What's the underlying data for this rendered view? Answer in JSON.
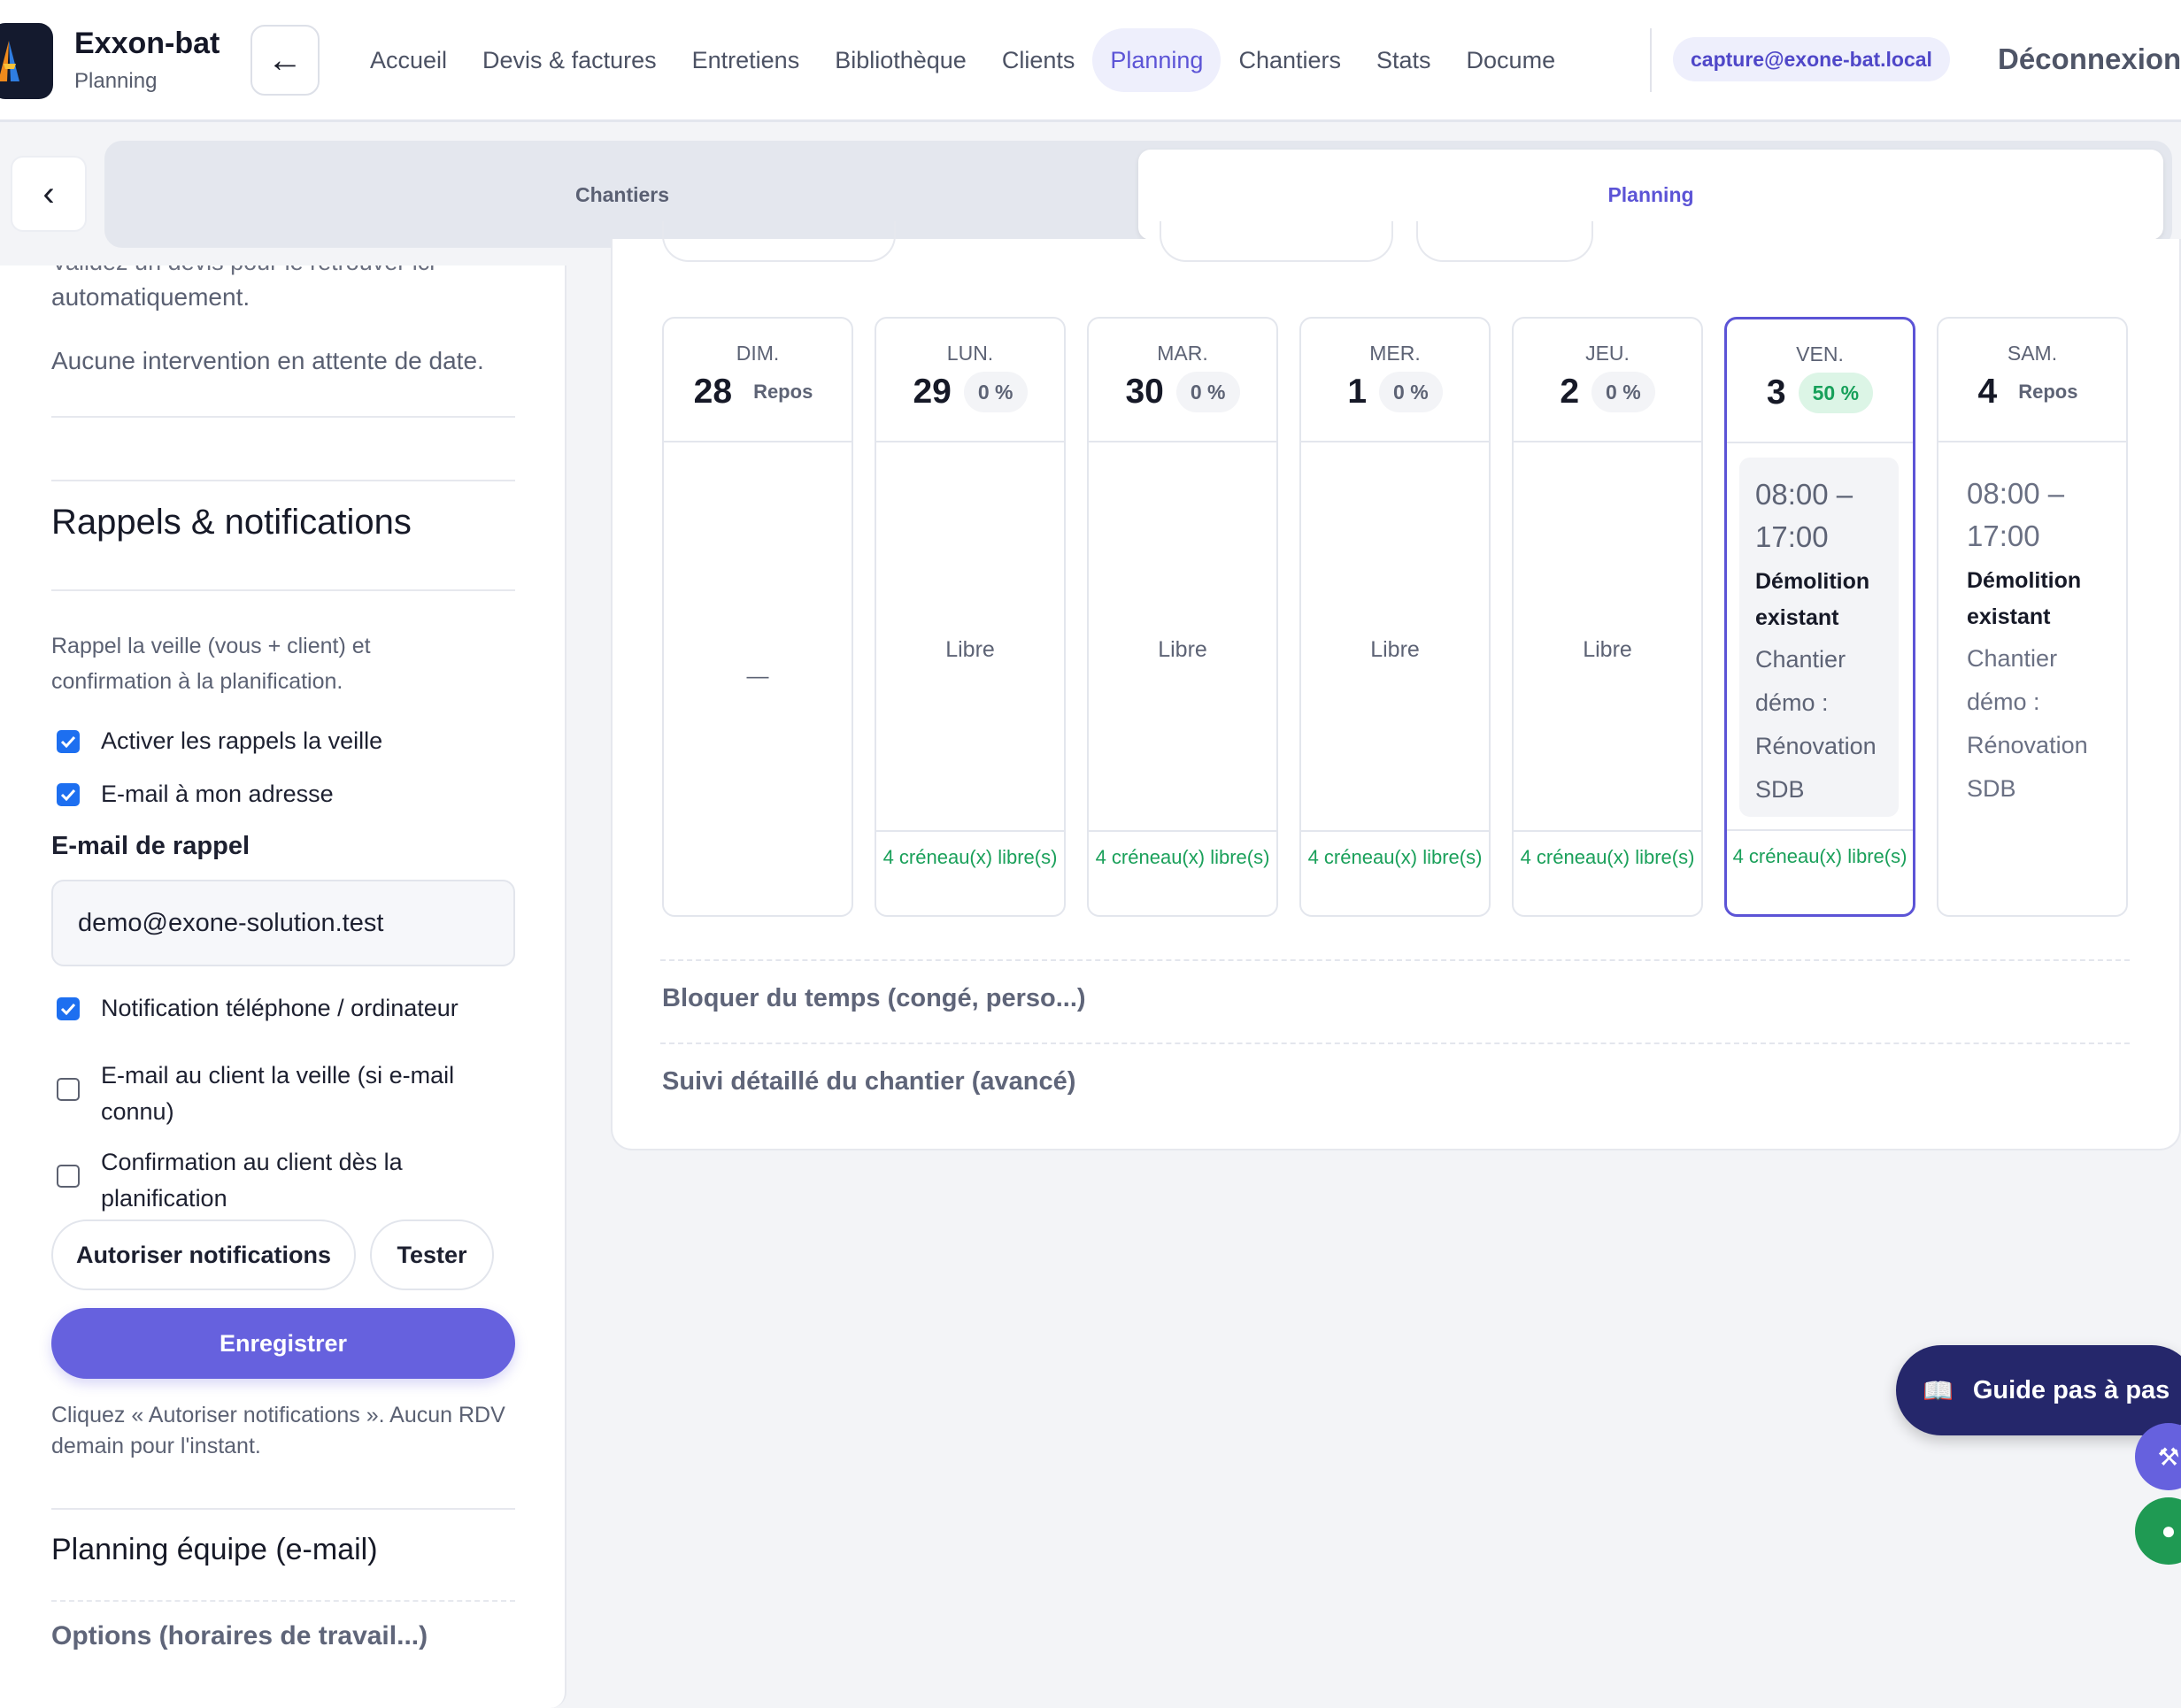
{
  "header": {
    "app_name": "Exxon-bat",
    "app_subtitle": "Planning",
    "back_icon": "arrow-left-icon",
    "nav": [
      {
        "label": "Accueil",
        "active": false
      },
      {
        "label": "Devis & factures",
        "active": false
      },
      {
        "label": "Entretiens",
        "active": false
      },
      {
        "label": "Bibliothèque",
        "active": false
      },
      {
        "label": "Clients",
        "active": false
      },
      {
        "label": "Planning",
        "active": true
      },
      {
        "label": "Chantiers",
        "active": false
      },
      {
        "label": "Stats",
        "active": false
      },
      {
        "label": "Docume",
        "active": false
      }
    ],
    "user_email": "capture@exone-bat.local",
    "logout": "Déconnexion"
  },
  "segment": {
    "tab_left": "Chantiers",
    "tab_right": "Planning",
    "active": "Planning"
  },
  "left_panel": {
    "cut_text": "Validez un devis pour le retrouver ici automatiquement.",
    "cut_text_visible": "automatiquement.",
    "no_intervention": "Aucune intervention en attente de date.",
    "reminders_title": "Rappels & notifications",
    "reminders_desc": "Rappel la veille (vous + client) et confirmation à la planification.",
    "checkboxes": [
      {
        "label": "Activer les rappels la veille",
        "checked": true
      },
      {
        "label": "E-mail à mon adresse",
        "checked": true
      }
    ],
    "email_label": "E-mail de rappel",
    "email_value": "demo@exone-solution.test",
    "checkboxes2": [
      {
        "label": "Notification téléphone / ordinateur",
        "checked": true
      },
      {
        "label": "E-mail au client la veille (si e-mail connu)",
        "checked": false
      },
      {
        "label": "Confirmation au client dès la planification",
        "checked": false
      }
    ],
    "btn_authorize": "Autoriser notifications",
    "btn_test": "Tester",
    "btn_save": "Enregistrer",
    "status_text": "Cliquez « Autoriser notifications ». Aucun RDV demain pour l'instant.",
    "team_planning": "Planning équipe (e-mail)",
    "options": "Options (horaires de travail...)"
  },
  "week": [
    {
      "name": "DIM.",
      "num": "28",
      "badge": "Repos",
      "badge_type": "rest",
      "body": "—",
      "footer": "",
      "selected": false,
      "event": null
    },
    {
      "name": "LUN.",
      "num": "29",
      "badge": "0 %",
      "badge_type": "grey",
      "body": "Libre",
      "footer": "4 créneau(x) libre(s)",
      "selected": false,
      "event": null
    },
    {
      "name": "MAR.",
      "num": "30",
      "badge": "0 %",
      "badge_type": "grey",
      "body": "Libre",
      "footer": "4 créneau(x) libre(s)",
      "selected": false,
      "event": null
    },
    {
      "name": "MER.",
      "num": "1",
      "badge": "0 %",
      "badge_type": "grey",
      "body": "Libre",
      "footer": "4 créneau(x) libre(s)",
      "selected": false,
      "event": null
    },
    {
      "name": "JEU.",
      "num": "2",
      "badge": "0 %",
      "badge_type": "grey",
      "body": "Libre",
      "footer": "4 créneau(x) libre(s)",
      "selected": false,
      "event": null
    },
    {
      "name": "VEN.",
      "num": "3",
      "badge": "50 %",
      "badge_type": "green",
      "body": "",
      "footer": "4 créneau(x) libre(s)",
      "selected": true,
      "event": {
        "time": "08:00 – 17:00",
        "title": "Démolition existant",
        "desc": "Chantier démo : Rénovation SDB"
      }
    },
    {
      "name": "SAM.",
      "num": "4",
      "badge": "Repos",
      "badge_type": "rest",
      "body": "",
      "footer": "",
      "selected": false,
      "event": {
        "time": "08:00 – 17:00",
        "title": "Démolition existant",
        "desc": "Chantier démo : Rénovation SDB"
      }
    }
  ],
  "card_links": {
    "block_time": "Bloquer du temps (congé, perso...)",
    "detailed_follow": "Suivi détaillé du chantier (avancé)"
  },
  "floating": {
    "guide_label": "Guide pas à pas",
    "guide_icon": "book-icon",
    "tools_icon": "tools-icon",
    "user_icon": "user-icon"
  },
  "colors": {
    "accent": "#5c54d6",
    "save_button": "#6661de",
    "free_green": "#1aa05a",
    "guide_navy": "#25276b"
  }
}
